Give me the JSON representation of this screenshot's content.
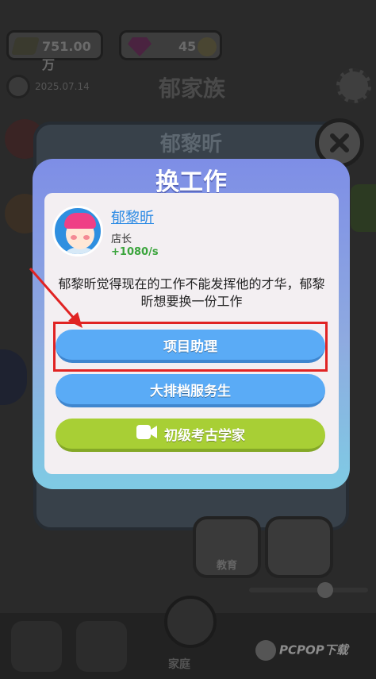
{
  "background": {
    "cash_value": "751.00万",
    "gem_count": "45",
    "date": "2025.07.14",
    "family_name": "郁家族",
    "card_name": "郁黎昕",
    "education_label": "教育",
    "home_label": "家庭",
    "watermark": "PCPOP下载"
  },
  "dialog": {
    "title": "换工作",
    "person": {
      "name": "郁黎昕",
      "job": "店长",
      "rate": "+1080/s"
    },
    "message": "郁黎昕觉得现在的工作不能发挥他的才华，郁黎昕想要换一份工作",
    "options": [
      {
        "label": "项目助理",
        "style": "blue"
      },
      {
        "label": "大排档服务生",
        "style": "blue"
      },
      {
        "label": "初级考古学家",
        "style": "green",
        "icon": "video-icon"
      }
    ]
  },
  "colors": {
    "dialog_top": "#7e8ee6",
    "dialog_bottom": "#7fcbe4",
    "blue_button": "#5aabf6",
    "green_button": "#a8cf35",
    "annotation_red": "#e02323"
  }
}
